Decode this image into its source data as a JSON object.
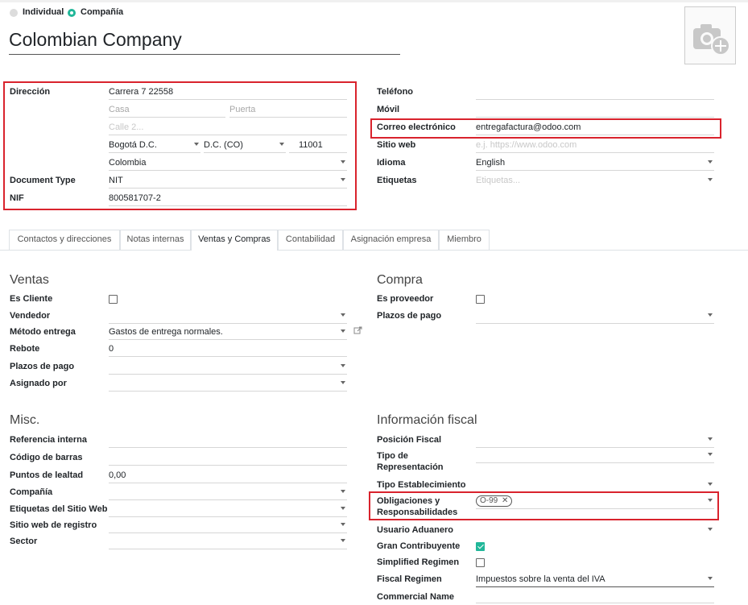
{
  "company_type": {
    "options": [
      "Individual",
      "Compañía"
    ],
    "selected": "Compañía"
  },
  "company_name": "Colombian Company",
  "photo": {
    "icon": "camera-add-icon"
  },
  "address": {
    "label": "Dirección",
    "street": "Carrera 7 22558",
    "casa_placeholder": "Casa",
    "puerta_placeholder": "Puerta",
    "street2_placeholder": "Calle 2...",
    "city": "Bogotá D.C.",
    "state": "D.C. (CO)",
    "zip": "11001",
    "country": "Colombia"
  },
  "document_type": {
    "label": "Document Type",
    "value": "NIT"
  },
  "nif": {
    "label": "NIF",
    "value": "800581707-2"
  },
  "contact": {
    "telefono_label": "Teléfono",
    "movil_label": "Móvil",
    "email_label": "Correo electrónico",
    "email_value": "entregafactura@odoo.com",
    "website_label": "Sitio web",
    "website_placeholder": "e.j. https://www.odoo.com",
    "lang_label": "Idioma",
    "lang_value": "English",
    "tags_label": "Etiquetas",
    "tags_placeholder": "Etiquetas..."
  },
  "tabs": [
    {
      "label": "Contactos y direcciones"
    },
    {
      "label": "Notas internas"
    },
    {
      "label": "Ventas y Compras"
    },
    {
      "label": "Contabilidad"
    },
    {
      "label": "Asignación empresa"
    },
    {
      "label": "Miembro"
    }
  ],
  "active_tab": "Ventas y Compras",
  "ventas": {
    "title": "Ventas",
    "es_cliente_label": "Es Cliente",
    "vendedor_label": "Vendedor",
    "metodo_entrega_label": "Método entrega",
    "metodo_entrega_value": "Gastos de entrega normales.",
    "rebote_label": "Rebote",
    "rebote_value": "0",
    "plazos_label": "Plazos de pago",
    "asignado_label": "Asignado por"
  },
  "compra": {
    "title": "Compra",
    "es_proveedor_label": "Es proveedor",
    "plazos_label": "Plazos de pago"
  },
  "misc": {
    "title": "Misc.",
    "ref_label": "Referencia interna",
    "barcode_label": "Código de barras",
    "loyalty_label": "Puntos de lealtad",
    "loyalty_value": "0,00",
    "company_label": "Compañía",
    "web_tags_label": "Etiquetas del Sitio Web",
    "web_reg_label": "Sitio web de registro",
    "sector_label": "Sector"
  },
  "fiscal": {
    "title": "Información fiscal",
    "posicion_label": "Posición Fiscal",
    "tipo_rep_label_1": "Tipo de",
    "tipo_rep_label_2": "Representación",
    "tipo_estab_label": "Tipo Establecimiento",
    "oblig_label_1": "Obligaciones y",
    "oblig_label_2": "Responsabilidades",
    "oblig_tag": "O-99",
    "aduanero_label": "Usuario Aduanero",
    "gran_label": "Gran Contribuyente",
    "gran_checked": true,
    "simplified_label": "Simplified Regimen",
    "regimen_label": "Fiscal Regimen",
    "regimen_value": "Impuestos sobre la venta del IVA",
    "commercial_label": "Commercial Name"
  },
  "colors": {
    "accent": "#21b799",
    "highlight": "#d9232d"
  }
}
